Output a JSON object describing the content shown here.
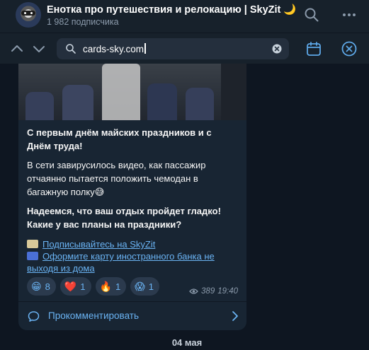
{
  "header": {
    "title": "Енотка про путешествия и релокацию | SkyZit 🌙",
    "subscribers": "1 982 подписчика"
  },
  "search": {
    "query": "cards-sky.com"
  },
  "message": {
    "line1": "С первым днём майских праздников и с",
    "line2": "Днём труда!",
    "para2_line1": "В сети завирусилось видео, как пассажир",
    "para2_line2": "отчаянно пытается положить чемодан в",
    "para2_line3": "багажную полку😅",
    "para3_line1": "Надеемся, что ваш отдых пройдет гладко!",
    "para3_line2": "Какие у вас планы на праздники?",
    "link1": "Подписывайтесь на SkyZit",
    "link2_line1": "Оформите карту иностранного банка не",
    "link2_line2": "выходя из дома",
    "reactions": [
      {
        "emoji": "😁",
        "count": "8"
      },
      {
        "emoji": "❤️",
        "count": "1"
      },
      {
        "emoji": "🔥",
        "count": "1"
      },
      {
        "emoji": "😱",
        "count": "1"
      }
    ],
    "views": "389",
    "time": "19:40",
    "comment_label": "Прокомментировать"
  },
  "date_separator": "04 мая",
  "colors": {
    "background": "#0e1621",
    "header": "#17212b",
    "bubble": "#182533",
    "accent": "#6ab3f3"
  }
}
